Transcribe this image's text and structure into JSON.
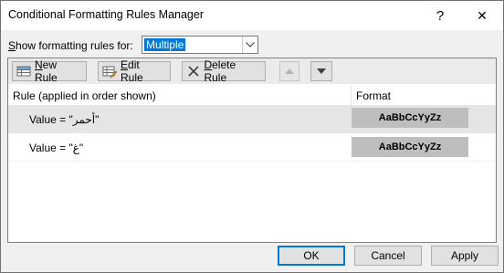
{
  "window": {
    "title": "Conditional Formatting Rules Manager",
    "help_glyph": "?",
    "close_glyph": "✕"
  },
  "show_rules": {
    "label_prefix": "",
    "label_access": "S",
    "label_rest": "how formatting rules for:",
    "selected": "Multiple"
  },
  "toolbar": {
    "new_access": "N",
    "new_rest": "ew Rule",
    "edit_access": "E",
    "edit_rest": "dit Rule",
    "delete_access": "D",
    "delete_rest": "elete Rule"
  },
  "table": {
    "col_rule": "Rule (applied in order shown)",
    "col_format": "Format",
    "rows": [
      {
        "rule": "Value = \"أحمر\"",
        "format_preview": "AaBbCcYyZz"
      },
      {
        "rule": "Value = \"غ\"",
        "format_preview": "AaBbCcYyZz"
      }
    ]
  },
  "footer": {
    "ok": "OK",
    "cancel": "Cancel",
    "apply": "Apply"
  }
}
